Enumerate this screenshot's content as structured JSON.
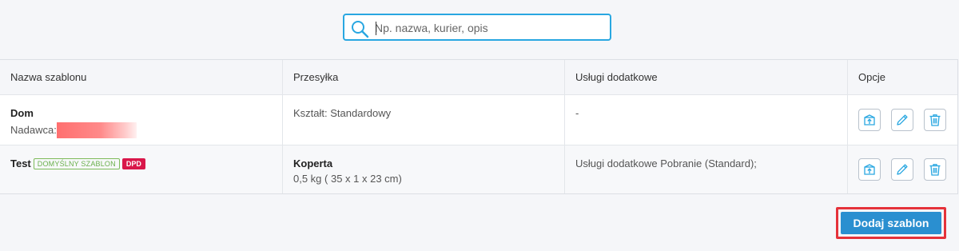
{
  "search": {
    "placeholder": "Np. nazwa, kurier, opis",
    "value": ""
  },
  "table": {
    "headers": [
      "Nazwa szablonu",
      "Przesyłka",
      "Usługi dodatkowe",
      "Opcje"
    ],
    "rows": [
      {
        "name": "Dom",
        "sender_label": "Nadawca:",
        "shipment_line1": "Kształt: Standardowy",
        "services": "-"
      },
      {
        "name": "Test",
        "default_badge": "DOMYŚLNY SZABLON",
        "courier_badge": "DPD",
        "shipment_title": "Koperta",
        "shipment_line1": "0,5 kg ( 35 x 1 x 23 cm)",
        "services": "Usługi dodatkowe Pobranie (Standard);"
      }
    ]
  },
  "actions": {
    "icons": [
      "upload-box-icon",
      "pencil-icon",
      "trash-icon"
    ]
  },
  "add_button": {
    "label": "Dodaj szablon"
  },
  "colors": {
    "accent": "#29a7e1",
    "button": "#2a8fd0",
    "highlight": "#e5323a",
    "badge_default": "#6ab04c",
    "badge_courier": "#d9174a"
  }
}
